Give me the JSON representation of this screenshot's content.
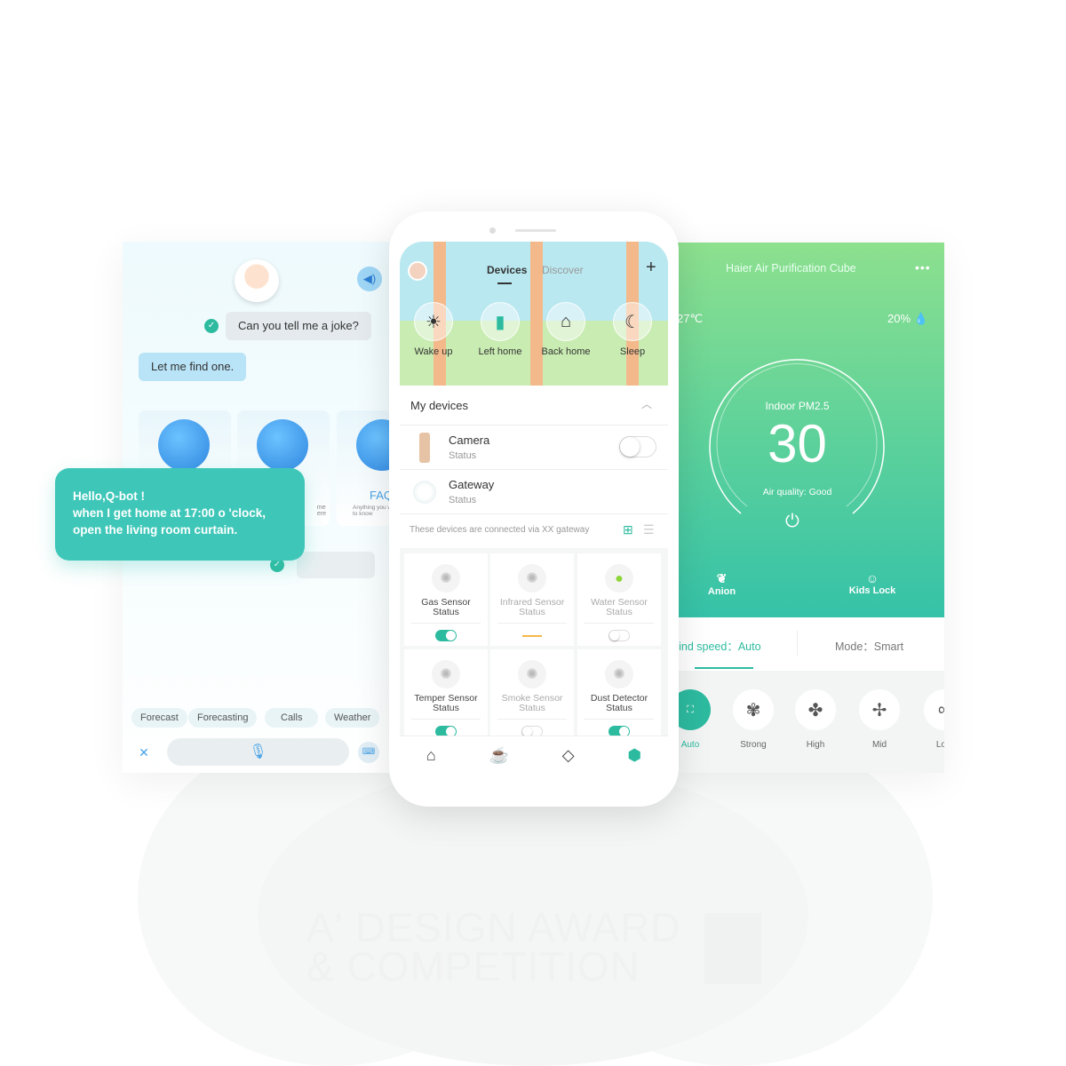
{
  "colors": {
    "accent": "#2dbba0",
    "bubble_teal": "#3ec7b8",
    "bot_bubble": "#b9e3f6",
    "green_top": "#8de08e"
  },
  "chat": {
    "user_message": "Can you tell me a joke?",
    "bot_reply": "Let me find one.",
    "cards": [
      {
        "title": "",
        "desc": ""
      },
      {
        "title": "",
        "desc": "me\nere"
      },
      {
        "title": "FAQ",
        "desc": "Anything you want to know"
      }
    ],
    "voice_message": "Hello,Q-bot !\nwhen I get home at 17:00 o 'clock,\nopen the living room curtain.",
    "chips": [
      "Forecast",
      "Forecasting",
      "Calls",
      "Weather"
    ],
    "icons": [
      "speaker-icon",
      "check-icon",
      "close-icon",
      "microphone-icon",
      "keyboard-icon"
    ]
  },
  "phone": {
    "tabs": [
      "Devices",
      "Discover"
    ],
    "scenes": [
      {
        "label": "Wake up",
        "icon": "sunrise-icon"
      },
      {
        "label": "Left home",
        "icon": "bag-icon"
      },
      {
        "label": "Back home",
        "icon": "sofa-icon"
      },
      {
        "label": "Sleep",
        "icon": "moon-icon"
      }
    ],
    "my_devices_title": "My devices",
    "devices": [
      {
        "name": "Camera",
        "status": "Status",
        "toggle": false
      },
      {
        "name": "Gateway",
        "status": "Status"
      }
    ],
    "gateway_note": "These devices are connected via XX gateway",
    "sensors": [
      {
        "name": "Gas Sensor",
        "status": "Status",
        "state": "on",
        "active": true
      },
      {
        "name": "Infrared Sensor",
        "status": "Status",
        "state": "dash",
        "active": false
      },
      {
        "name": "Water Sensor",
        "status": "Status",
        "state": "off",
        "active": false
      },
      {
        "name": "Temper Sensor",
        "status": "Status",
        "state": "on",
        "active": true
      },
      {
        "name": "Smoke Sensor",
        "status": "Status",
        "state": "off",
        "active": false
      },
      {
        "name": "Dust Detector",
        "status": "Status",
        "state": "on",
        "active": true
      }
    ],
    "nav": [
      "home-icon",
      "service-icon",
      "discover-icon",
      "devices-icon"
    ]
  },
  "purifier": {
    "title": "Haier Air Purification Cube",
    "temperature": "27℃",
    "humidity": "20%",
    "pm_label": "Indoor PM2.5",
    "pm_value": "30",
    "air_quality": "Air quality: Good",
    "features": [
      "Anion",
      "Kids Lock"
    ],
    "wind_speed": "Vind speed：Auto",
    "mode": "Mode：Smart",
    "speeds": [
      "Auto",
      "Strong",
      "High",
      "Mid",
      "Low"
    ],
    "selected_speed": "Auto"
  },
  "watermark": "A' DESIGN AWARD\n& COMPETITION"
}
